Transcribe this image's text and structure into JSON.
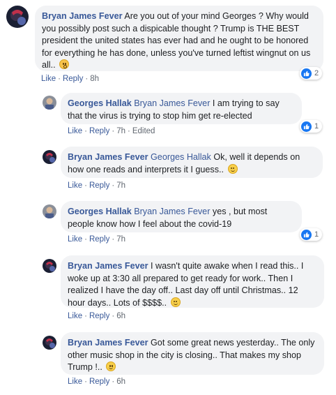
{
  "comments": [
    {
      "author": "Bryan James Fever",
      "mention": "",
      "text": "Are you out of your mind Georges ? Why would you possibly post such a dispicable thought ? Trump is THE BEST president the united states has ever had and he ought to be honored for everything he has done, unless you've turned leftist wingnut on us all..",
      "emoji": "flushed-face-icon",
      "like": "Like",
      "reply": "Reply",
      "time": "8h",
      "edited": "",
      "reactions": "2"
    },
    {
      "author": "Georges Hallak",
      "mention": "Bryan James Fever",
      "text": "I am trying to say that the virus is trying to stop him get re-elected",
      "emoji": "",
      "like": "Like",
      "reply": "Reply",
      "time": "7h",
      "edited": "Edited",
      "reactions": "1"
    },
    {
      "author": "Bryan James Fever",
      "mention": "Georges Hallak",
      "text": "Ok, well it depends on how one reads and interprets it I guess..",
      "emoji": "smiling-face-icon",
      "like": "Like",
      "reply": "Reply",
      "time": "7h",
      "edited": "",
      "reactions": ""
    },
    {
      "author": "Georges Hallak",
      "mention": "Bryan James Fever",
      "text": "yes , but most people know how I feel about the covid-19",
      "emoji": "",
      "like": "Like",
      "reply": "Reply",
      "time": "7h",
      "edited": "",
      "reactions": "1"
    },
    {
      "author": "Bryan James Fever",
      "mention": "",
      "text": "I wasn't quite awake when I read this.. I woke up at 3:30 all prepared to get ready for work.. Then I realized I have the day off.. Last day off until Christmas.. 12 hour days.. Lots of $$$$..",
      "emoji": "smiling-face-icon",
      "like": "Like",
      "reply": "Reply",
      "time": "6h",
      "edited": "",
      "reactions": ""
    },
    {
      "author": "Bryan James Fever",
      "mention": "",
      "text": "Got some great news yesterday.. The only other music shop in the city is closing.. That makes my shop Trump !..",
      "emoji": "smiling-face-icon",
      "like": "Like",
      "reply": "Reply",
      "time": "6h",
      "edited": "",
      "reactions": ""
    }
  ],
  "colors": {
    "link": "#385898",
    "bubble": "#f2f3f5",
    "like_blue": "#1877f2"
  },
  "icons": {
    "reaction": "like-thumb-icon"
  }
}
